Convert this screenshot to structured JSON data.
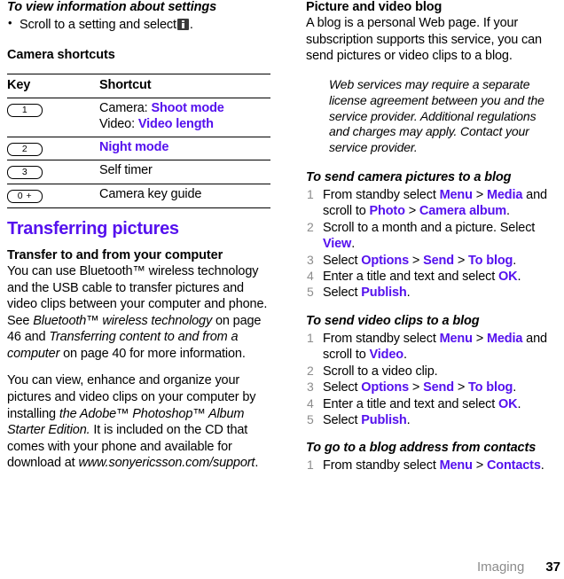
{
  "footer": {
    "section": "Imaging",
    "page_number": "37"
  },
  "left_column": {
    "proc_heading": "To view information about settings",
    "bullet": {
      "text_before": "Scroll to a setting and select",
      "icon": "info-icon",
      "text_after": "."
    },
    "table_heading": "Camera shortcuts",
    "table": {
      "columns": [
        "Key",
        "Shortcut"
      ],
      "rows": [
        {
          "key": "1",
          "lines": [
            {
              "prefix": "Camera: ",
              "link": "Shoot mode",
              "suffix": ""
            },
            {
              "prefix": "Video: ",
              "link": "Video length",
              "suffix": ""
            }
          ]
        },
        {
          "key": "2",
          "lines": [
            {
              "prefix": "",
              "link": "Night mode",
              "suffix": ""
            }
          ]
        },
        {
          "key": "3",
          "lines": [
            {
              "prefix": "Self timer",
              "link": "",
              "suffix": ""
            }
          ]
        },
        {
          "key": "0 +",
          "lines": [
            {
              "prefix": "Camera key guide",
              "link": "",
              "suffix": ""
            }
          ]
        }
      ]
    },
    "section_heading": "Transferring pictures",
    "sub_heading": "Transfer to and from your computer",
    "paragraph_1": {
      "part_1": "You can use Bluetooth™ wireless technology and the USB cable to transfer pictures and video clips between your computer and phone. See ",
      "italic_1": "Bluetooth™ wireless technology",
      "part_2": " on page 46 and ",
      "italic_2": "Transferring content to and from a computer",
      "part_3": " on page 40 for more information."
    },
    "paragraph_2": {
      "part_1": "You can view, enhance and organize your pictures and video clips on your computer by installing ",
      "italic_1": "the Adobe™ Photoshop™ Album Starter Edition.",
      "part_2": " It is included on the CD that comes with your phone and available for download at ",
      "italic_2": "www.sonyericsson.com/support",
      "part_3": "."
    }
  },
  "right_column": {
    "sub_heading": "Picture and video blog",
    "paragraph_1": "A blog is a personal Web page. If your subscription supports this service, you can send pictures or video clips to a blog.",
    "note": {
      "icon": "exclamation-icon",
      "text": "Web services may require a separate license agreement between you and the service provider. Additional regulations and charges may apply. Contact your service provider."
    },
    "procedures": [
      {
        "title": "To send camera pictures to a blog",
        "steps": [
          [
            {
              "t": "text",
              "v": "From standby select "
            },
            {
              "t": "ui",
              "v": "Menu"
            },
            {
              "t": "text",
              "v": " > "
            },
            {
              "t": "ui",
              "v": "Media"
            },
            {
              "t": "text",
              "v": " and scroll to "
            },
            {
              "t": "ui",
              "v": "Photo"
            },
            {
              "t": "text",
              "v": " > "
            },
            {
              "t": "ui",
              "v": "Camera album"
            },
            {
              "t": "text",
              "v": "."
            }
          ],
          [
            {
              "t": "text",
              "v": "Scroll to a month and a picture. Select "
            },
            {
              "t": "ui",
              "v": "View"
            },
            {
              "t": "text",
              "v": "."
            }
          ],
          [
            {
              "t": "text",
              "v": "Select "
            },
            {
              "t": "ui",
              "v": "Options"
            },
            {
              "t": "text",
              "v": " > "
            },
            {
              "t": "ui",
              "v": "Send"
            },
            {
              "t": "text",
              "v": " > "
            },
            {
              "t": "ui",
              "v": "To blog"
            },
            {
              "t": "text",
              "v": "."
            }
          ],
          [
            {
              "t": "text",
              "v": "Enter a title and text and select "
            },
            {
              "t": "ui",
              "v": "OK"
            },
            {
              "t": "text",
              "v": "."
            }
          ],
          [
            {
              "t": "text",
              "v": "Select "
            },
            {
              "t": "ui",
              "v": "Publish"
            },
            {
              "t": "text",
              "v": "."
            }
          ]
        ]
      },
      {
        "title": "To send video clips to a blog",
        "steps": [
          [
            {
              "t": "text",
              "v": "From standby select "
            },
            {
              "t": "ui",
              "v": "Menu"
            },
            {
              "t": "text",
              "v": " > "
            },
            {
              "t": "ui",
              "v": "Media"
            },
            {
              "t": "text",
              "v": " and scroll to "
            },
            {
              "t": "ui",
              "v": "Video"
            },
            {
              "t": "text",
              "v": "."
            }
          ],
          [
            {
              "t": "text",
              "v": "Scroll to a video clip."
            }
          ],
          [
            {
              "t": "text",
              "v": "Select "
            },
            {
              "t": "ui",
              "v": "Options"
            },
            {
              "t": "text",
              "v": " > "
            },
            {
              "t": "ui",
              "v": "Send"
            },
            {
              "t": "text",
              "v": " > "
            },
            {
              "t": "ui",
              "v": "To blog"
            },
            {
              "t": "text",
              "v": "."
            }
          ],
          [
            {
              "t": "text",
              "v": "Enter a title and text and select "
            },
            {
              "t": "ui",
              "v": "OK"
            },
            {
              "t": "text",
              "v": "."
            }
          ],
          [
            {
              "t": "text",
              "v": "Select "
            },
            {
              "t": "ui",
              "v": "Publish"
            },
            {
              "t": "text",
              "v": "."
            }
          ]
        ]
      },
      {
        "title": "To go to a blog address from contacts",
        "steps": [
          [
            {
              "t": "text",
              "v": "From standby select "
            },
            {
              "t": "ui",
              "v": "Menu"
            },
            {
              "t": "text",
              "v": " > "
            },
            {
              "t": "ui",
              "v": "Contacts"
            },
            {
              "t": "text",
              "v": "."
            }
          ]
        ]
      }
    ]
  },
  "colors": {
    "link_purple": "#5511ee",
    "step_number_gray": "#8c8c8c",
    "footer_gray": "#8c8c8c",
    "text_black": "#000000"
  }
}
